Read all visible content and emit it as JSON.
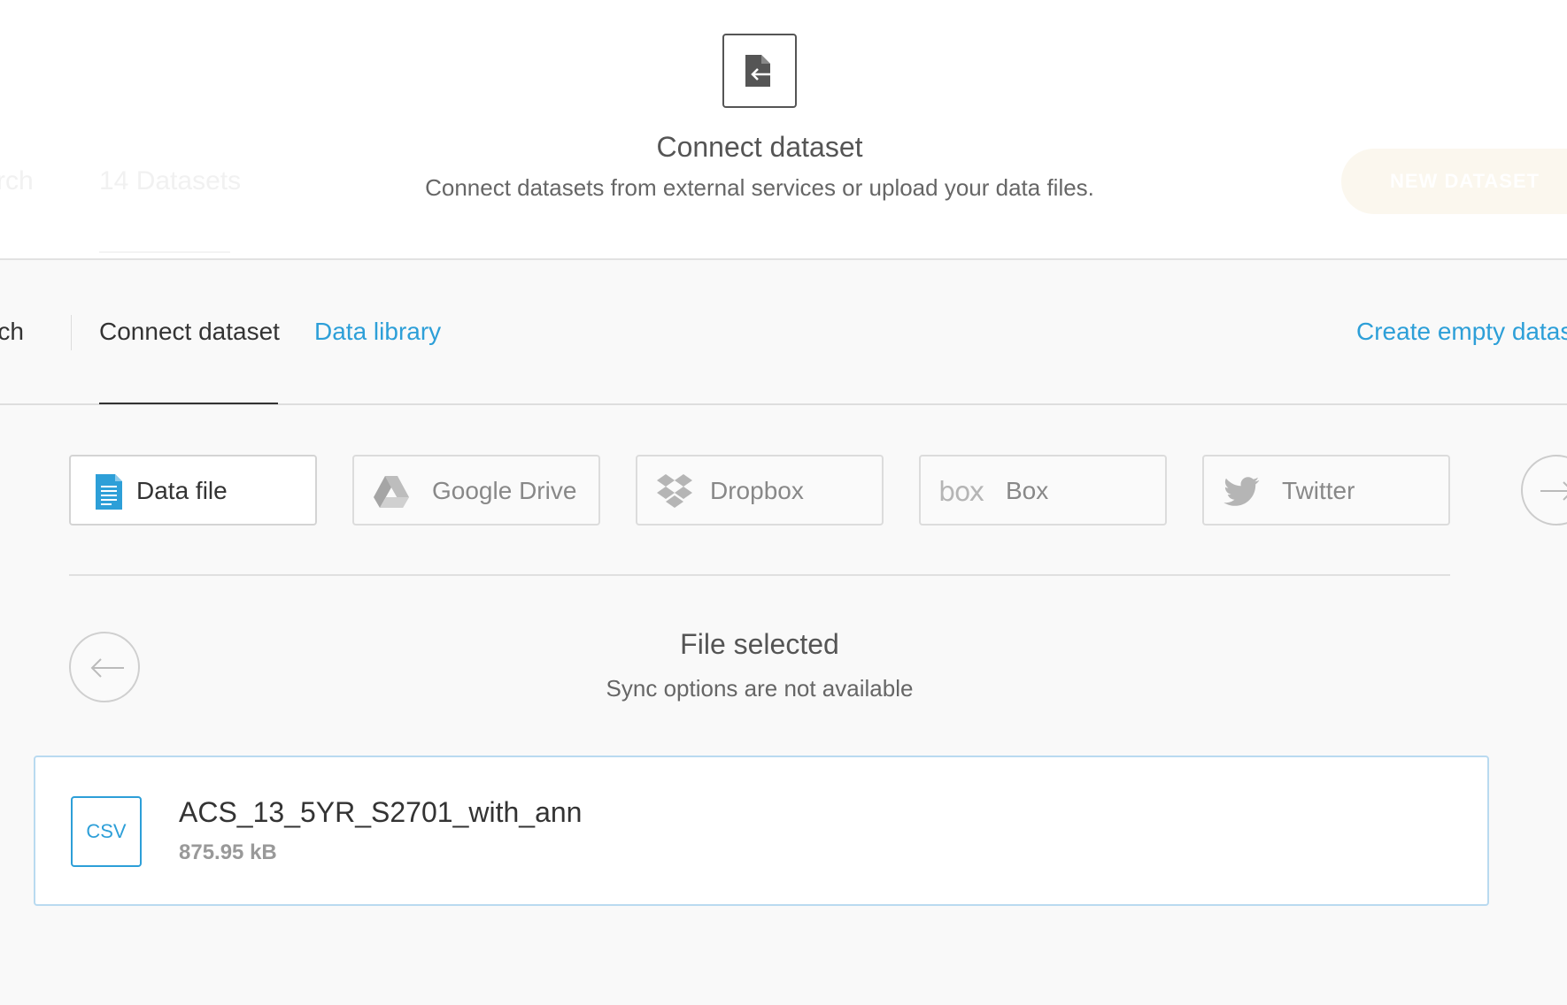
{
  "background_header": {
    "search_label": "rch",
    "datasets_count": "14 Datasets",
    "new_dataset_button": "NEW DATASET"
  },
  "header": {
    "title": "Connect dataset",
    "subtitle": "Connect datasets from external services or upload your data files.",
    "icon": "import-icon"
  },
  "tabs": {
    "search_label": "rch",
    "connect": "Connect dataset",
    "library": "Data library",
    "create_empty": "Create empty datas"
  },
  "sources": [
    {
      "label": "Data file",
      "icon": "document-icon",
      "active": true
    },
    {
      "label": "Google Drive",
      "icon": "google-drive-icon",
      "active": false
    },
    {
      "label": "Dropbox",
      "icon": "dropbox-icon",
      "active": false
    },
    {
      "label": "Box",
      "icon": "box-logo",
      "active": false
    },
    {
      "label": "Twitter",
      "icon": "twitter-icon",
      "active": false
    }
  ],
  "file_selected": {
    "title": "File selected",
    "subtitle": "Sync options are not available"
  },
  "file": {
    "type": "CSV",
    "name": "ACS_13_5YR_S2701_with_ann",
    "size": "875.95 kB"
  },
  "colors": {
    "accent": "#2d9fd8",
    "text": "#333333",
    "muted": "#888888",
    "card_border": "#b9daf0"
  }
}
